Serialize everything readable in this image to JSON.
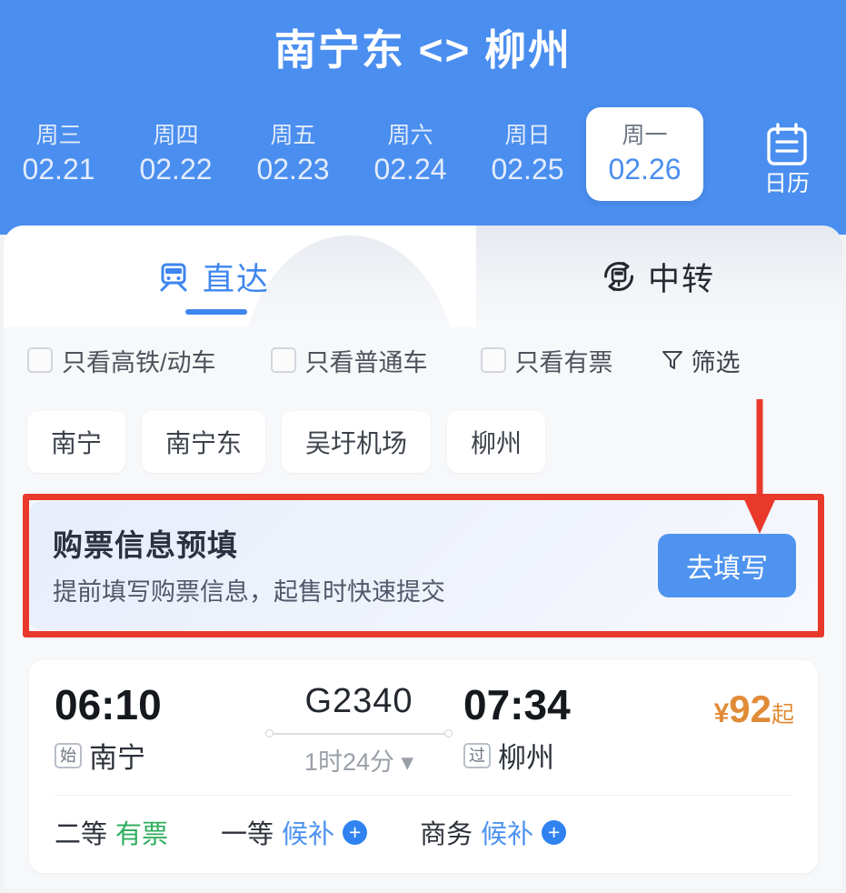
{
  "header": {
    "route_title": "南宁东 <> 柳州",
    "dates": [
      {
        "dow": "周三",
        "date": "02.21",
        "active": false
      },
      {
        "dow": "周四",
        "date": "02.22",
        "active": false
      },
      {
        "dow": "周五",
        "date": "02.23",
        "active": false
      },
      {
        "dow": "周六",
        "date": "02.24",
        "active": false
      },
      {
        "dow": "周日",
        "date": "02.25",
        "active": false
      },
      {
        "dow": "周一",
        "date": "02.26",
        "active": true
      }
    ],
    "calendar": {
      "label": "日历",
      "icon": "calendar-icon"
    }
  },
  "tabs": {
    "direct": {
      "label": "直达",
      "icon": "train-icon",
      "active": true
    },
    "transfer": {
      "label": "中转",
      "icon": "transfer-train-icon",
      "active": false
    }
  },
  "filters": {
    "checkboxes": [
      {
        "label": "只看高铁/动车",
        "checked": false
      },
      {
        "label": "只看普通车",
        "checked": false
      },
      {
        "label": "只看有票",
        "checked": false
      }
    ],
    "filter_button": {
      "label": "筛选",
      "icon": "funnel-icon"
    }
  },
  "station_chips": [
    {
      "label": "南宁"
    },
    {
      "label": "南宁东"
    },
    {
      "label": "吴圩机场"
    },
    {
      "label": "柳州"
    }
  ],
  "prefill_banner": {
    "title": "购票信息预填",
    "subtitle": "提前填写购票信息，起售时快速提交",
    "button_label": "去填写",
    "highlight_color": "#e8392b",
    "button_color": "#4e93ef"
  },
  "annotation": {
    "arrow": "down-arrow-annotation",
    "color": "#e8392b"
  },
  "train_list": [
    {
      "depart_time": "06:10",
      "depart_badge": "始",
      "depart_station": "南宁",
      "train_no": "G2340",
      "duration": "1时24分",
      "arrive_time": "07:34",
      "arrive_badge": "过",
      "arrive_station": "柳州",
      "price_currency": "¥",
      "price_amount": "92",
      "price_suffix": "起",
      "price_color": "#e08b37",
      "seats": [
        {
          "name": "二等",
          "status": "有票",
          "state": "available",
          "has_plus": false
        },
        {
          "name": "一等",
          "status": "候补",
          "state": "waitlist",
          "has_plus": true
        },
        {
          "name": "商务",
          "status": "候补",
          "state": "waitlist",
          "has_plus": true
        }
      ]
    }
  ]
}
